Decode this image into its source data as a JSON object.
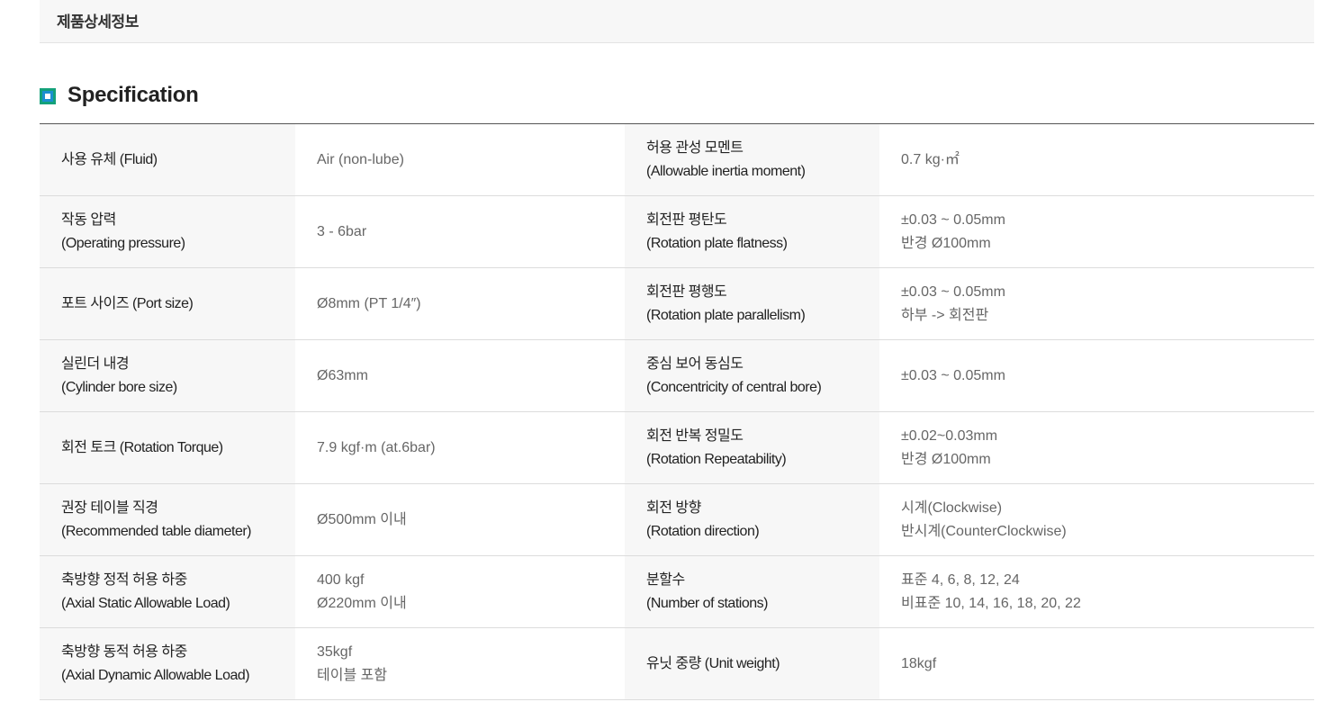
{
  "tab": {
    "label": "제품상세정보"
  },
  "section": {
    "title": "Specification"
  },
  "rows": [
    {
      "l1": [
        "사용 유체 (Fluid)"
      ],
      "v1": [
        "Air (non-lube)"
      ],
      "l2": [
        "허용 관성 모멘트",
        "(Allowable inertia moment)"
      ],
      "v2": [
        "0.7 kg·㎡"
      ]
    },
    {
      "l1": [
        "작동 압력",
        "(Operating pressure)"
      ],
      "v1": [
        "3 - 6bar"
      ],
      "l2": [
        "회전판 평탄도",
        "(Rotation plate flatness)"
      ],
      "v2": [
        "±0.03 ~ 0.05mm",
        "반경 Ø100mm"
      ]
    },
    {
      "l1": [
        "포트 사이즈 (Port size)"
      ],
      "v1": [
        "Ø8mm (PT 1/4″)"
      ],
      "l2": [
        "회전판 평행도",
        "(Rotation plate parallelism)"
      ],
      "v2": [
        "±0.03 ~ 0.05mm",
        "하부 -> 회전판"
      ]
    },
    {
      "l1": [
        "실린더 내경",
        "(Cylinder bore size)"
      ],
      "v1": [
        "Ø63mm"
      ],
      "l2": [
        "중심 보어 동심도",
        "(Concentricity of central bore)"
      ],
      "v2": [
        "±0.03 ~ 0.05mm"
      ]
    },
    {
      "l1": [
        "회전 토크 (Rotation Torque)"
      ],
      "v1": [
        "7.9 kgf·m (at.6bar)"
      ],
      "l2": [
        "회전 반복 정밀도",
        "(Rotation Repeatability)"
      ],
      "v2": [
        "±0.02~0.03mm",
        "반경 Ø100mm"
      ]
    },
    {
      "l1": [
        "권장 테이블 직경",
        "(Recommended table diameter)"
      ],
      "v1": [
        "Ø500mm 이내"
      ],
      "l2": [
        "회전 방향",
        "(Rotation direction)"
      ],
      "v2": [
        "시계(Clockwise)",
        "반시계(CounterClockwise)"
      ]
    },
    {
      "l1": [
        "축방향 정적 허용 하중",
        "(Axial Static Allowable Load)"
      ],
      "v1": [
        "400 kgf",
        "Ø220mm 이내"
      ],
      "l2": [
        "분할수",
        "(Number of stations)"
      ],
      "v2": [
        "표준 4, 6, 8, 12, 24",
        "비표준 10, 14, 16, 18, 20, 22"
      ]
    },
    {
      "l1": [
        "축방향 동적 허용 하중",
        "(Axial Dynamic Allowable Load)"
      ],
      "v1": [
        "35kgf",
        "테이블 포함"
      ],
      "l2": [
        "유닛 중량 (Unit weight)"
      ],
      "v2": [
        "18kgf"
      ]
    }
  ]
}
